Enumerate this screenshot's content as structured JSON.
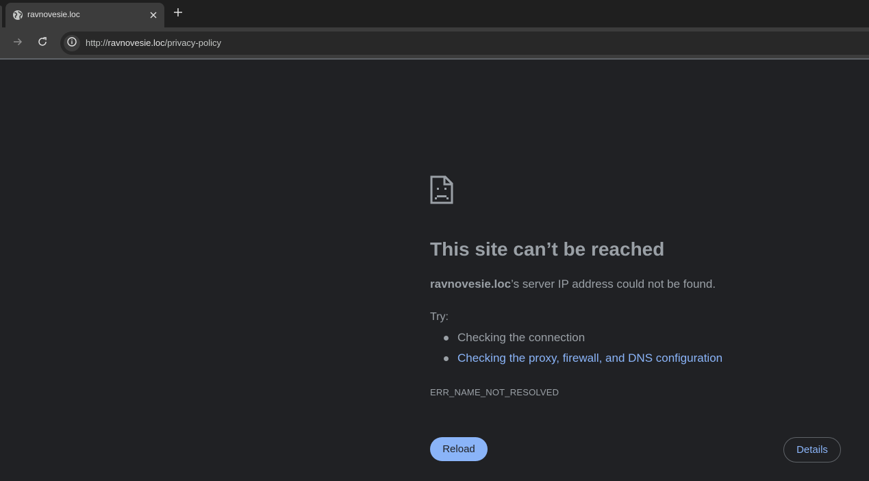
{
  "browser": {
    "tab": {
      "title": "ravnovesie.loc",
      "favicon": "globe-icon"
    },
    "new_tab_icon": "plus-icon",
    "close_tab_icon": "close-icon",
    "nav": {
      "forward_icon": "arrow-right-icon",
      "reload_icon": "reload-icon"
    },
    "omnibox": {
      "security_icon": "info-icon",
      "url_scheme": "http://",
      "url_host": "ravnovesie.loc",
      "url_path": "/privacy-policy"
    }
  },
  "error_page": {
    "icon": "sad-document-icon",
    "heading": "This site can’t be reached",
    "summary_host": "ravnovesie.loc",
    "summary_rest": "’s server IP address could not be found.",
    "try_label": "Try:",
    "suggestions": [
      {
        "text": "Checking the connection",
        "link": false
      },
      {
        "text": "Checking the proxy, firewall, and DNS configuration",
        "link": true
      }
    ],
    "error_code": "ERR_NAME_NOT_RESOLVED",
    "reload_label": "Reload",
    "details_label": "Details"
  },
  "colors": {
    "page_bg": "#202124",
    "toolbar_bg": "#3c3c3c",
    "text": "#9aa0a6",
    "link": "#8ab4f8"
  }
}
